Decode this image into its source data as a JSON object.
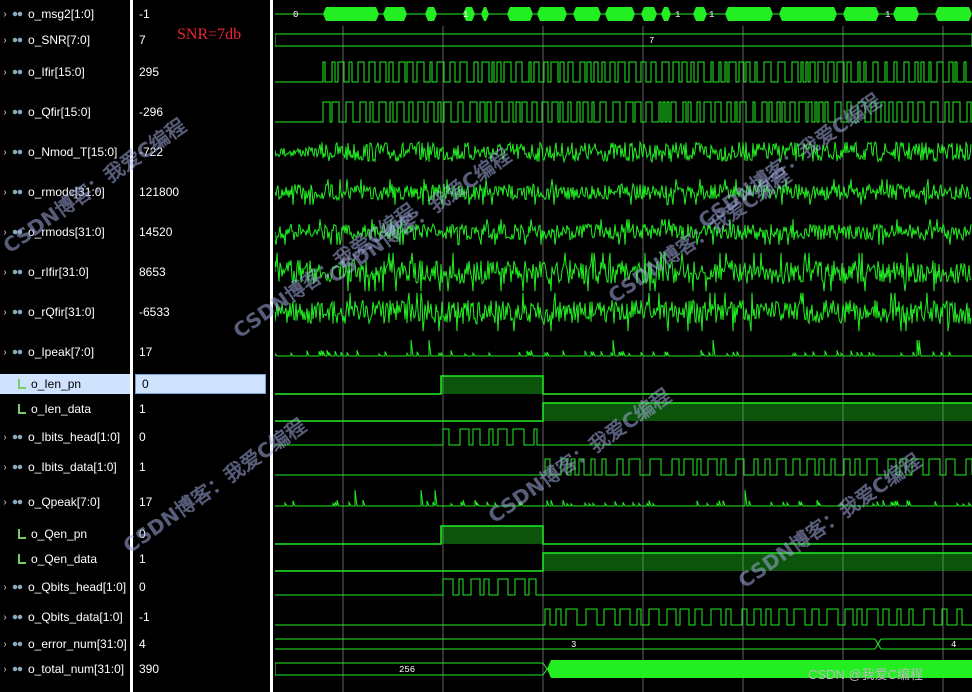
{
  "annotation": {
    "snr_label": "SNR=7db"
  },
  "signals": [
    {
      "name": "o_msg2[1:0]",
      "value": "-1",
      "kind": "bus",
      "expandable": true
    },
    {
      "name": "o_SNR[7:0]",
      "value": "7",
      "kind": "bus",
      "expandable": true
    },
    {
      "name": "o_Ifir[15:0]",
      "value": "295",
      "kind": "bus",
      "expandable": true
    },
    {
      "name": "o_Qfir[15:0]",
      "value": "-296",
      "kind": "bus",
      "expandable": true
    },
    {
      "name": "o_Nmod_T[15:0]",
      "value": "-722",
      "kind": "bus",
      "expandable": true
    },
    {
      "name": "o_rmodc[31:0]",
      "value": "121800",
      "kind": "bus",
      "expandable": true
    },
    {
      "name": "o_rmods[31:0]",
      "value": "14520",
      "kind": "bus",
      "expandable": true
    },
    {
      "name": "o_rIfir[31:0]",
      "value": "8653",
      "kind": "bus",
      "expandable": true
    },
    {
      "name": "o_rQfir[31:0]",
      "value": "-6533",
      "kind": "bus",
      "expandable": true
    },
    {
      "name": "o_Ipeak[7:0]",
      "value": "17",
      "kind": "bus",
      "expandable": true
    },
    {
      "name": "o_Ien_pn",
      "value": "0",
      "kind": "bit",
      "expandable": false,
      "selected": true
    },
    {
      "name": "o_Ien_data",
      "value": "1",
      "kind": "bit",
      "expandable": false
    },
    {
      "name": "o_Ibits_head[1:0]",
      "value": "0",
      "kind": "bus",
      "expandable": true
    },
    {
      "name": "o_Ibits_data[1:0]",
      "value": "1",
      "kind": "bus",
      "expandable": true
    },
    {
      "name": "o_Qpeak[7:0]",
      "value": "17",
      "kind": "bus",
      "expandable": true
    },
    {
      "name": "o_Qen_pn",
      "value": "0",
      "kind": "bit",
      "expandable": false
    },
    {
      "name": "o_Qen_data",
      "value": "1",
      "kind": "bit",
      "expandable": false
    },
    {
      "name": "o_Qbits_head[1:0]",
      "value": "0",
      "kind": "bus",
      "expandable": true
    },
    {
      "name": "o_Qbits_data[1:0]",
      "value": "-1",
      "kind": "bus",
      "expandable": true
    },
    {
      "name": "o_error_num[31:0]",
      "value": "4",
      "kind": "bus",
      "expandable": true
    },
    {
      "name": "o_total_num[31:0]",
      "value": "390",
      "kind": "bus",
      "expandable": true
    }
  ],
  "bus_labels": {
    "msg2_start": "0",
    "msg2_marker": "1",
    "snr_value": "7",
    "error_num_before": "3",
    "error_num_after": "4",
    "total_num_before": "256"
  },
  "watermarks": {
    "blog_text": "CSDN博客：我爱C编程",
    "footer": "CSDN @我爱C编程"
  },
  "colors": {
    "wave": "#22ee22",
    "background": "#000000",
    "grid": "#cfcfcf",
    "selection": "#cfe3ff",
    "snr_text": "#e22233"
  }
}
